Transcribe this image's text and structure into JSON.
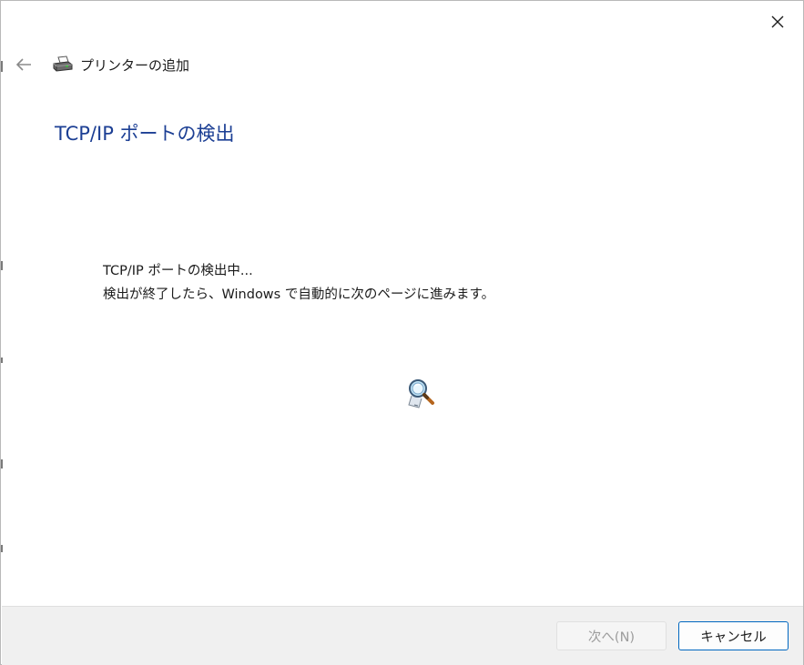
{
  "window": {
    "close_icon": "close-icon"
  },
  "header": {
    "back_icon": "back-arrow-icon",
    "app_icon": "printer-icon",
    "title": "プリンターの追加"
  },
  "main": {
    "page_title": "TCP/IP ポートの検出",
    "message_line1": "TCP/IP ポートの検出中...",
    "message_line2": "検出が終了したら、Windows で自動的に次のページに進みます。",
    "animation_icon": "search-magnifier-icon"
  },
  "footer": {
    "next_label": "次へ(N)",
    "next_enabled": false,
    "cancel_label": "キャンセル"
  },
  "colors": {
    "title_blue": "#1c3f94",
    "accent": "#0067c0",
    "footer_bg": "#f0f0f0"
  }
}
